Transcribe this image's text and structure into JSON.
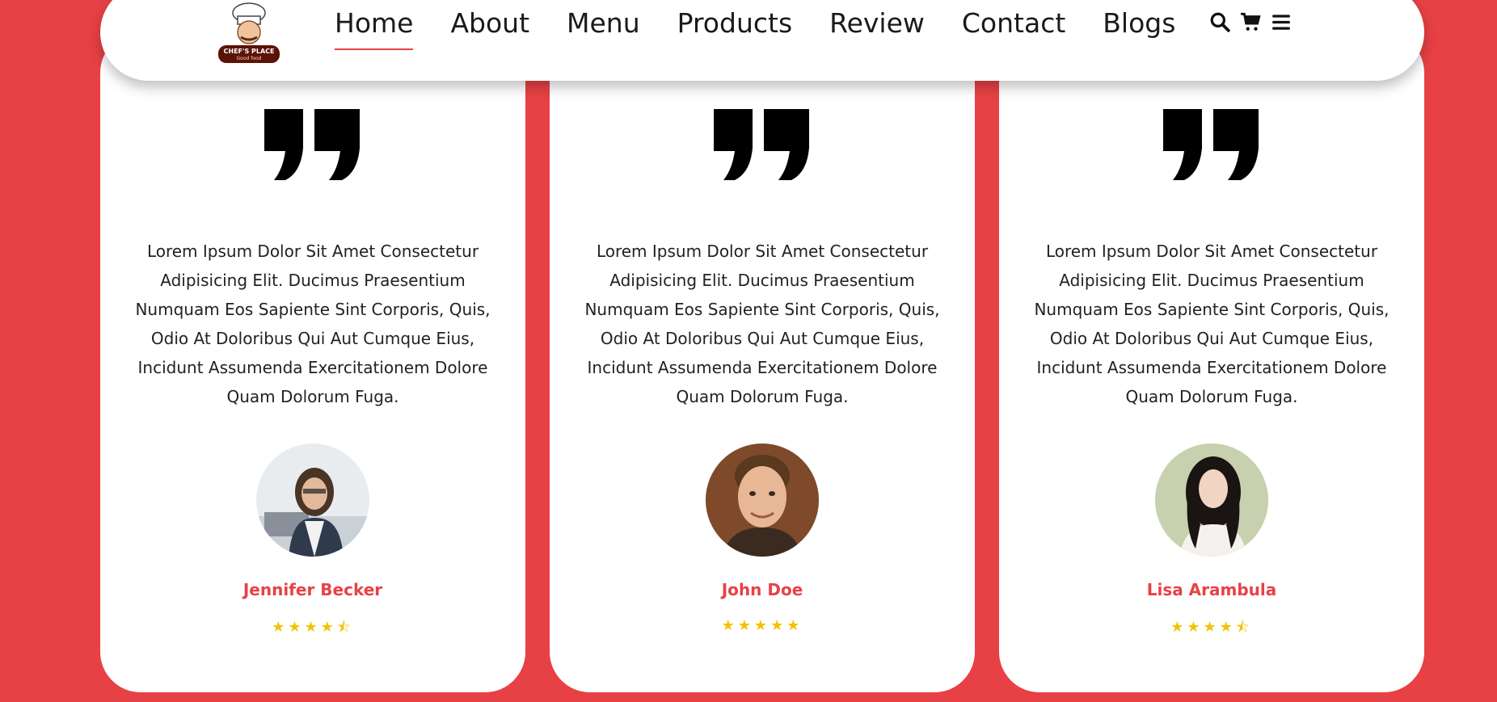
{
  "header": {
    "logo": {
      "line1": "CHEF'S PLACE",
      "line2": "Good food"
    },
    "nav": [
      {
        "label": "Home",
        "active": true
      },
      {
        "label": "About"
      },
      {
        "label": "Menu"
      },
      {
        "label": "Products"
      },
      {
        "label": "Review"
      },
      {
        "label": "Contact"
      },
      {
        "label": "Blogs"
      }
    ],
    "icons": [
      "search-icon",
      "cart-icon",
      "menu-icon"
    ]
  },
  "reviews": [
    {
      "text": "Lorem Ipsum Dolor Sit Amet Consectetur Adipisicing Elit. Ducimus Praesentium Numquam Eos Sapiente Sint Corporis, Quis, Odio At Doloribus Qui Aut Cumque Eius, Incidunt Assumenda Exercitationem Dolore Quam Dolorum Fuga.",
      "name": "Jennifer Becker",
      "rating": 4.5
    },
    {
      "text": "Lorem Ipsum Dolor Sit Amet Consectetur Adipisicing Elit. Ducimus Praesentium Numquam Eos Sapiente Sint Corporis, Quis, Odio At Doloribus Qui Aut Cumque Eius, Incidunt Assumenda Exercitationem Dolore Quam Dolorum Fuga.",
      "name": "John Doe",
      "rating": 5
    },
    {
      "text": "Lorem Ipsum Dolor Sit Amet Consectetur Adipisicing Elit. Ducimus Praesentium Numquam Eos Sapiente Sint Corporis, Quis, Odio At Doloribus Qui Aut Cumque Eius, Incidunt Assumenda Exercitationem Dolore Quam Dolorum Fuga.",
      "name": "Lisa Arambula",
      "rating": 4.5
    }
  ],
  "colors": {
    "accent": "#e84145",
    "star": "#f2c200",
    "card": "#ffffff"
  }
}
